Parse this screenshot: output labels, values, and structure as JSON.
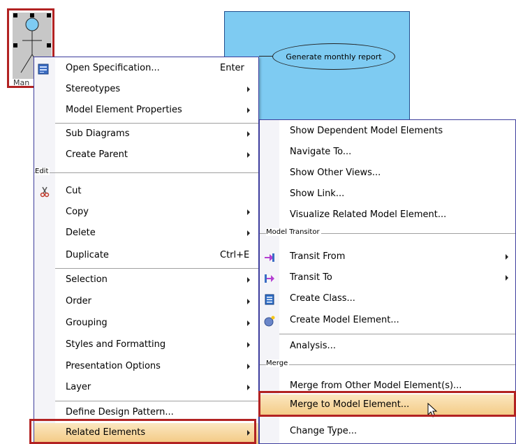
{
  "diagram": {
    "actor_label": "Man",
    "use_case_label": "Generate monthly report"
  },
  "main_menu": {
    "items": [
      {
        "label": "Open Specification...",
        "shortcut": "Enter"
      },
      {
        "label": "Stereotypes"
      },
      {
        "label": "Model Element Properties"
      },
      {
        "label": "Sub Diagrams"
      },
      {
        "label": "Create Parent"
      },
      {
        "label": "Cut"
      },
      {
        "label": "Copy"
      },
      {
        "label": "Delete"
      },
      {
        "label": "Duplicate",
        "shortcut": "Ctrl+E"
      },
      {
        "label": "Selection"
      },
      {
        "label": "Order"
      },
      {
        "label": "Grouping"
      },
      {
        "label": "Styles and Formatting"
      },
      {
        "label": "Presentation Options"
      },
      {
        "label": "Layer"
      },
      {
        "label": "Define Design Pattern..."
      },
      {
        "label": "Related Elements"
      }
    ],
    "group_edit": "Edit"
  },
  "sub_menu": {
    "items": [
      {
        "label": "Show Dependent Model Elements"
      },
      {
        "label": "Navigate To..."
      },
      {
        "label": "Show Other Views..."
      },
      {
        "label": "Show Link..."
      },
      {
        "label": "Visualize Related Model Element..."
      },
      {
        "label": "Transit From"
      },
      {
        "label": "Transit To"
      },
      {
        "label": "Create Class..."
      },
      {
        "label": "Create Model Element..."
      },
      {
        "label": "Analysis..."
      },
      {
        "label": "Merge from Other Model Element(s)..."
      },
      {
        "label": "Merge to Model Element..."
      },
      {
        "label": "Change Type..."
      }
    ],
    "group_model_transitor": "Model Transitor",
    "group_merge": "Merge"
  },
  "colors": {
    "highlight": "#f3c981",
    "selection_box": "#b22222",
    "diagram_fill": "#7ecbf2",
    "menu_border": "#3e3e9e"
  },
  "icons": {
    "open_spec": "specification-icon",
    "cut": "scissors-icon",
    "transit_from": "transit-from-icon",
    "transit_to": "transit-to-icon",
    "create_class": "class-icon",
    "create_model_element": "model-element-icon",
    "cursor": "mouse-pointer-icon"
  }
}
